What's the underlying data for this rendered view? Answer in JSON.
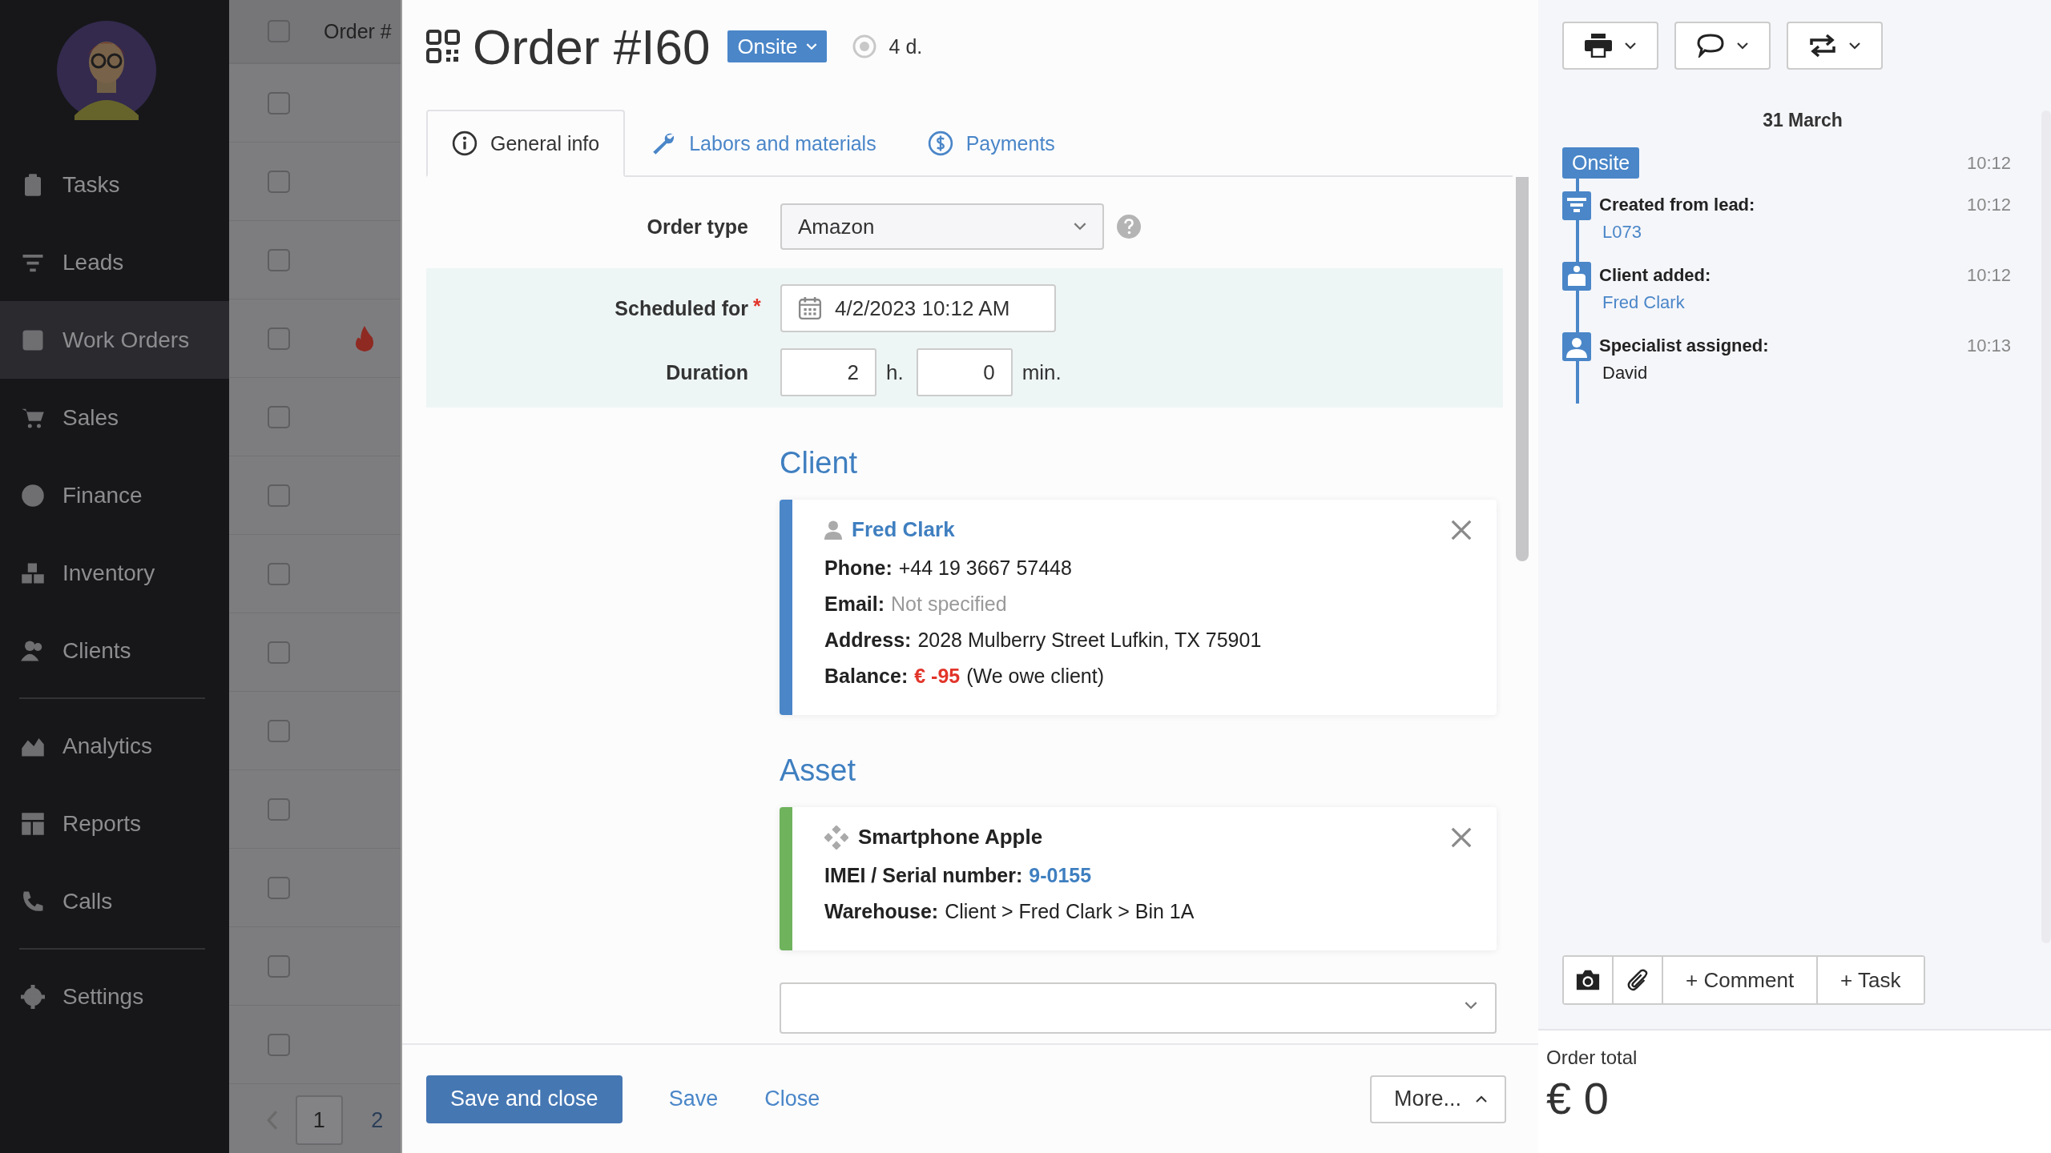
{
  "sidebar": {
    "groups": [
      {
        "items": [
          {
            "label": "Tasks",
            "selected": false
          },
          {
            "label": "Leads",
            "selected": false
          },
          {
            "label": "Work Orders",
            "selected": true
          },
          {
            "label": "Sales",
            "selected": false
          },
          {
            "label": "Finance",
            "selected": false
          },
          {
            "label": "Inventory",
            "selected": false
          },
          {
            "label": "Clients",
            "selected": false
          }
        ]
      },
      {
        "items": [
          {
            "label": "Analytics",
            "selected": false
          },
          {
            "label": "Reports",
            "selected": false
          },
          {
            "label": "Calls",
            "selected": false
          }
        ]
      },
      {
        "items": [
          {
            "label": "Settings",
            "selected": false
          }
        ]
      }
    ]
  },
  "background_table": {
    "columns": [
      "Order #"
    ],
    "header_checked": false,
    "rows": [
      {
        "checked": false,
        "hot": false
      },
      {
        "checked": false,
        "hot": false
      },
      {
        "checked": false,
        "hot": false
      },
      {
        "checked": false,
        "hot": true
      },
      {
        "checked": false,
        "hot": false
      },
      {
        "checked": false,
        "hot": false
      },
      {
        "checked": false,
        "hot": false
      },
      {
        "checked": false,
        "hot": false
      },
      {
        "checked": false,
        "hot": false
      },
      {
        "checked": false,
        "hot": false
      },
      {
        "checked": false,
        "hot": false
      },
      {
        "checked": false,
        "hot": false
      },
      {
        "checked": false,
        "hot": false
      }
    ],
    "pages": [
      {
        "label": "1",
        "selected": true
      },
      {
        "label": "2",
        "selected": false
      }
    ]
  },
  "order": {
    "title": "Order #I60",
    "status": "Onsite",
    "age": "4 d."
  },
  "tabs": [
    {
      "label": "General info",
      "selected": true
    },
    {
      "label": "Labors and materials",
      "selected": false
    },
    {
      "label": "Payments",
      "selected": false
    }
  ],
  "form": {
    "order_type": {
      "label": "Order type",
      "value": "Amazon"
    },
    "scheduled_for": {
      "label": "Scheduled for",
      "required_mark": "*",
      "value": "4/2/2023 10:12 AM"
    },
    "duration": {
      "label": "Duration",
      "hours": "2",
      "hours_unit": "h.",
      "minutes": "0",
      "minutes_unit": "min."
    }
  },
  "client": {
    "heading": "Client",
    "name": "Fred Clark",
    "fields": [
      {
        "label": "Phone:",
        "value": "+44 19 3667 57448",
        "kind": "text"
      },
      {
        "label": "Email:",
        "value": "Not specified",
        "kind": "empty"
      },
      {
        "label": "Address:",
        "value": "2028 Mulberry Street Lufkin, TX 75901",
        "kind": "text"
      },
      {
        "label": "Balance:",
        "value": "€ -95",
        "note": "(We owe client)",
        "kind": "negative"
      }
    ]
  },
  "asset": {
    "heading": "Asset",
    "name": "Smartphone Apple",
    "fields": [
      {
        "label": "IMEI / Serial number:",
        "value": "9-0155",
        "kind": "link"
      },
      {
        "label": "Warehouse:",
        "value": "Client > Fred Clark > Bin 1A",
        "kind": "text"
      }
    ]
  },
  "footer": {
    "save_and_close": "Save and close",
    "save": "Save",
    "close": "Close",
    "more": "More..."
  },
  "timeline": {
    "date": "31 March",
    "status": {
      "label": "Onsite",
      "time": "10:12"
    },
    "events": [
      {
        "kind": "lead",
        "title": "Created from lead:",
        "detail": "L073",
        "link": true,
        "time": "10:12"
      },
      {
        "kind": "client",
        "title": "Client added:",
        "detail": "Fred Clark",
        "link": true,
        "time": "10:12"
      },
      {
        "kind": "specialist",
        "title": "Specialist assigned:",
        "detail": "David",
        "link": false,
        "time": "10:13"
      }
    ]
  },
  "actions": {
    "comment": "+ Comment",
    "task": "+ Task"
  },
  "order_total": {
    "label": "Order total",
    "value": "€ 0"
  }
}
